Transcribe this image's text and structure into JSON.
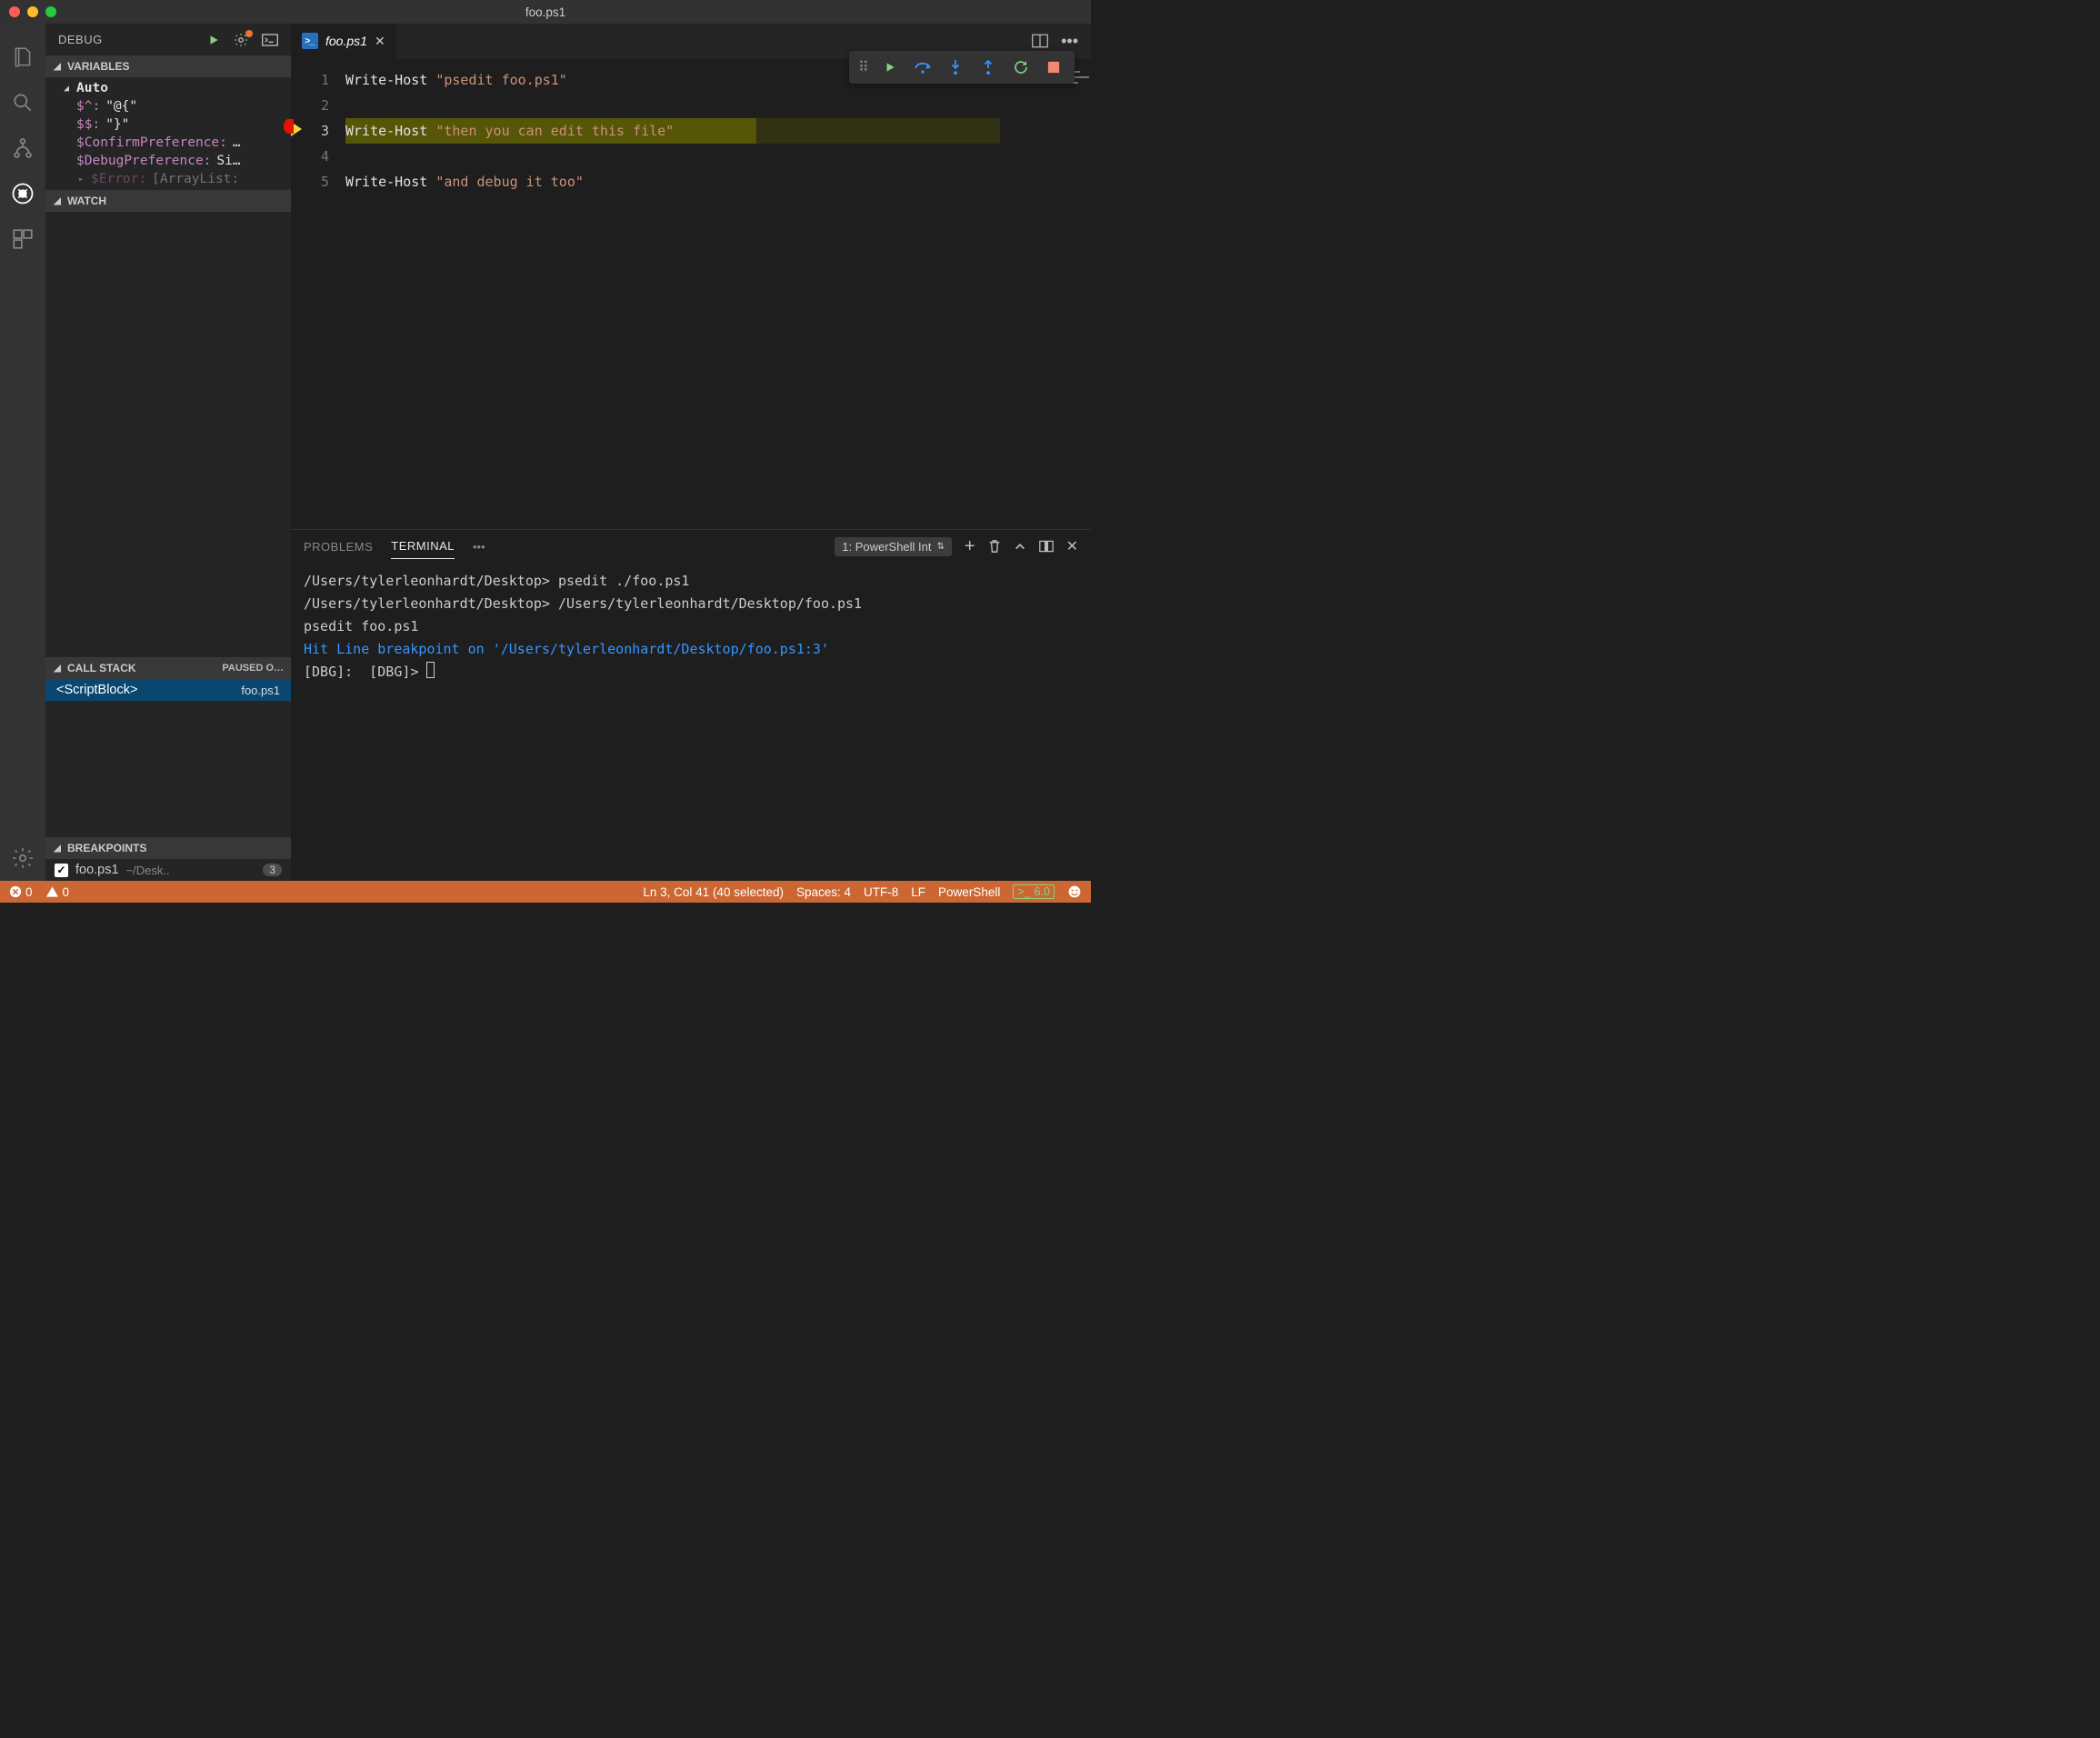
{
  "window": {
    "title": "foo.ps1"
  },
  "activity": {
    "items": [
      {
        "name": "explorer-icon"
      },
      {
        "name": "search-icon"
      },
      {
        "name": "scm-icon"
      },
      {
        "name": "debug-icon",
        "active": true
      },
      {
        "name": "extensions-icon"
      }
    ],
    "bottom": [
      {
        "name": "gear-icon"
      }
    ]
  },
  "debug_sidebar": {
    "title": "DEBUG",
    "sections": {
      "variables": {
        "label": "VARIABLES",
        "auto_label": "Auto",
        "items": [
          {
            "name": "$^:",
            "value": "\"@{\""
          },
          {
            "name": "$$:",
            "value": "\"}\""
          },
          {
            "name": "$ConfirmPreference:",
            "value": "…"
          },
          {
            "name": "$DebugPreference:",
            "value": "Si…"
          },
          {
            "name": "$Error:",
            "value": "[ArrayList:"
          }
        ]
      },
      "watch": {
        "label": "WATCH"
      },
      "callstack": {
        "label": "CALL STACK",
        "status": "PAUSED O…",
        "frames": [
          {
            "name": "<ScriptBlock>",
            "location": "foo.ps1"
          }
        ]
      },
      "breakpoints": {
        "label": "BREAKPOINTS",
        "items": [
          {
            "checked": true,
            "file": "foo.ps1",
            "path": "~/Desk..",
            "line": "3"
          }
        ]
      }
    }
  },
  "tabs": {
    "open": [
      {
        "label": "foo.ps1",
        "active": true
      }
    ]
  },
  "debug_toolbar": {
    "actions": [
      "continue",
      "step-over",
      "step-into",
      "step-out",
      "restart",
      "stop"
    ]
  },
  "editor": {
    "lines": [
      {
        "n": "1",
        "cmd": "Write-Host",
        "str": "\"psedit foo.ps1\""
      },
      {
        "n": "2"
      },
      {
        "n": "3",
        "cmd": "Write-Host",
        "str": "\"then you can edit this file\"",
        "current": true
      },
      {
        "n": "4"
      },
      {
        "n": "5",
        "cmd": "Write-Host",
        "str": "\"and debug it too\""
      }
    ]
  },
  "panel": {
    "tabs": {
      "problems": "PROBLEMS",
      "terminal": "TERMINAL"
    },
    "selector": "1: PowerShell Int",
    "terminal_lines": [
      {
        "t": "/Users/tylerleonhardt/Desktop> psedit ./foo.ps1"
      },
      {
        "t": "/Users/tylerleonhardt/Desktop> /Users/tylerleonhardt/Desktop/foo.ps1"
      },
      {
        "t": ""
      },
      {
        "t": ""
      },
      {
        "t": "psedit foo.ps1"
      },
      {
        "t": ""
      },
      {
        "t": "Hit Line breakpoint on '/Users/tylerleonhardt/Desktop/foo.ps1:3'",
        "cls": "term-blue"
      },
      {
        "t": ""
      },
      {
        "t": "[DBG]:  [DBG]> ",
        "cursor": true
      }
    ]
  },
  "statusbar": {
    "errors": "0",
    "warnings": "0",
    "cursor": "Ln 3, Col 41 (40 selected)",
    "spaces": "Spaces: 4",
    "encoding": "UTF-8",
    "eol": "LF",
    "lang": "PowerShell",
    "ps_version": "6.0"
  }
}
